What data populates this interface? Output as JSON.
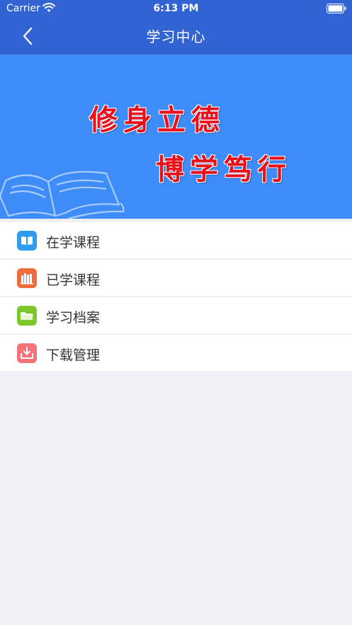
{
  "status_bar": {
    "carrier": "Carrier",
    "time": "6:13 PM"
  },
  "nav": {
    "title": "学习中心",
    "back_icon": "chevron-left-icon"
  },
  "banner": {
    "line1": "修身立德",
    "line2": "博学笃行",
    "background_color": "#3e8cf7",
    "text_color": "#e8101a"
  },
  "menu": {
    "items": [
      {
        "label": "在学课程",
        "icon": "open-book-icon",
        "icon_color": "#2f9cf0"
      },
      {
        "label": "已学课程",
        "icon": "books-icon",
        "icon_color": "#f26b3a"
      },
      {
        "label": "学习档案",
        "icon": "folder-icon",
        "icon_color": "#7cc82a"
      },
      {
        "label": "下载管理",
        "icon": "download-icon",
        "icon_color": "#f5727a"
      }
    ]
  },
  "colors": {
    "header": "#3163d2",
    "page_background": "#efeff4"
  }
}
